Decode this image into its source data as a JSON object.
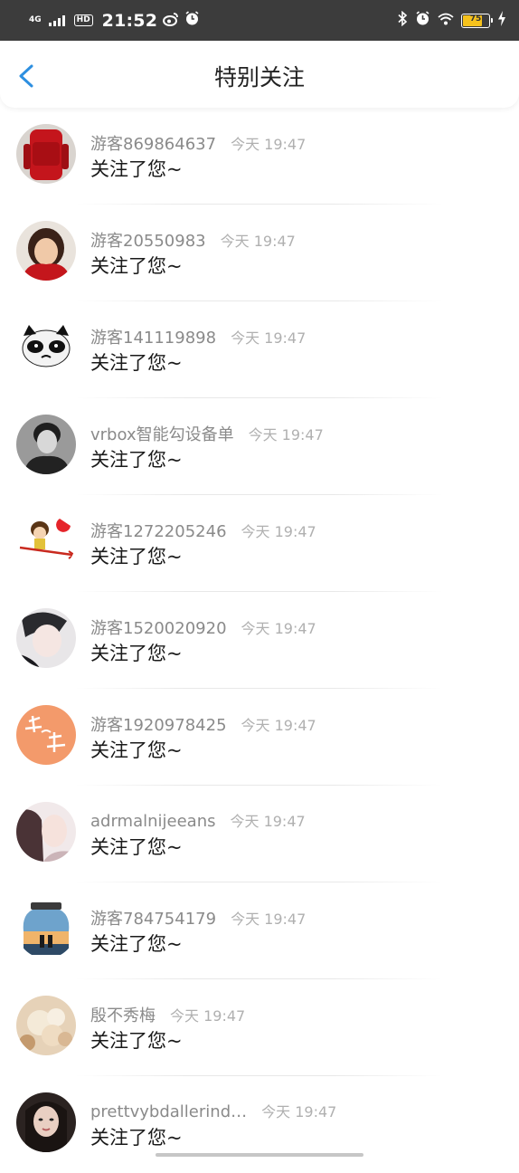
{
  "status_bar": {
    "network": "4G",
    "hd": "HD",
    "time": "21:52",
    "battery_level": "75",
    "icons": [
      "signal-icon",
      "weibo-icon",
      "alarm-icon",
      "bluetooth-icon",
      "alarm-icon",
      "wifi-icon",
      "battery-icon",
      "charging-icon"
    ]
  },
  "header": {
    "title": "特别关注",
    "back_icon": "chevron-left-icon",
    "accent": "#2d8fe0"
  },
  "items": [
    {
      "name": "游客869864637",
      "time": "今天 19:47",
      "message": "关注了您~",
      "avatar": "red-backpack"
    },
    {
      "name": "游客20550983",
      "time": "今天 19:47",
      "message": "关注了您~",
      "avatar": "girl-red-scarf"
    },
    {
      "name": "游客141119898",
      "time": "今天 19:47",
      "message": "关注了您~",
      "avatar": "panda-cat"
    },
    {
      "name": "vrbox智能勾设备单",
      "time": "今天 19:47",
      "message": "关注了您~",
      "avatar": "boy-bw"
    },
    {
      "name": "游客1272205246",
      "time": "今天 19:47",
      "message": "关注了您~",
      "avatar": "cartoon-cupid"
    },
    {
      "name": "游客1520020920",
      "time": "今天 19:47",
      "message": "关注了您~",
      "avatar": "boy-white"
    },
    {
      "name": "游客1920978425",
      "time": "今天 19:47",
      "message": "关注了您~",
      "avatar": "orange-calligraphy"
    },
    {
      "name": "adrmalnijeeans",
      "time": "今天 19:47",
      "message": "关注了您~",
      "avatar": "girl-hair"
    },
    {
      "name": "游客784754179",
      "time": "今天 19:47",
      "message": "关注了您~",
      "avatar": "jar-couple"
    },
    {
      "name": "殷不秀梅",
      "time": "今天 19:47",
      "message": "关注了您~",
      "avatar": "flowers"
    },
    {
      "name": "prettvybdallerind…",
      "time": "今天 19:47",
      "message": "关注了您~",
      "avatar": "girl-dark"
    }
  ]
}
